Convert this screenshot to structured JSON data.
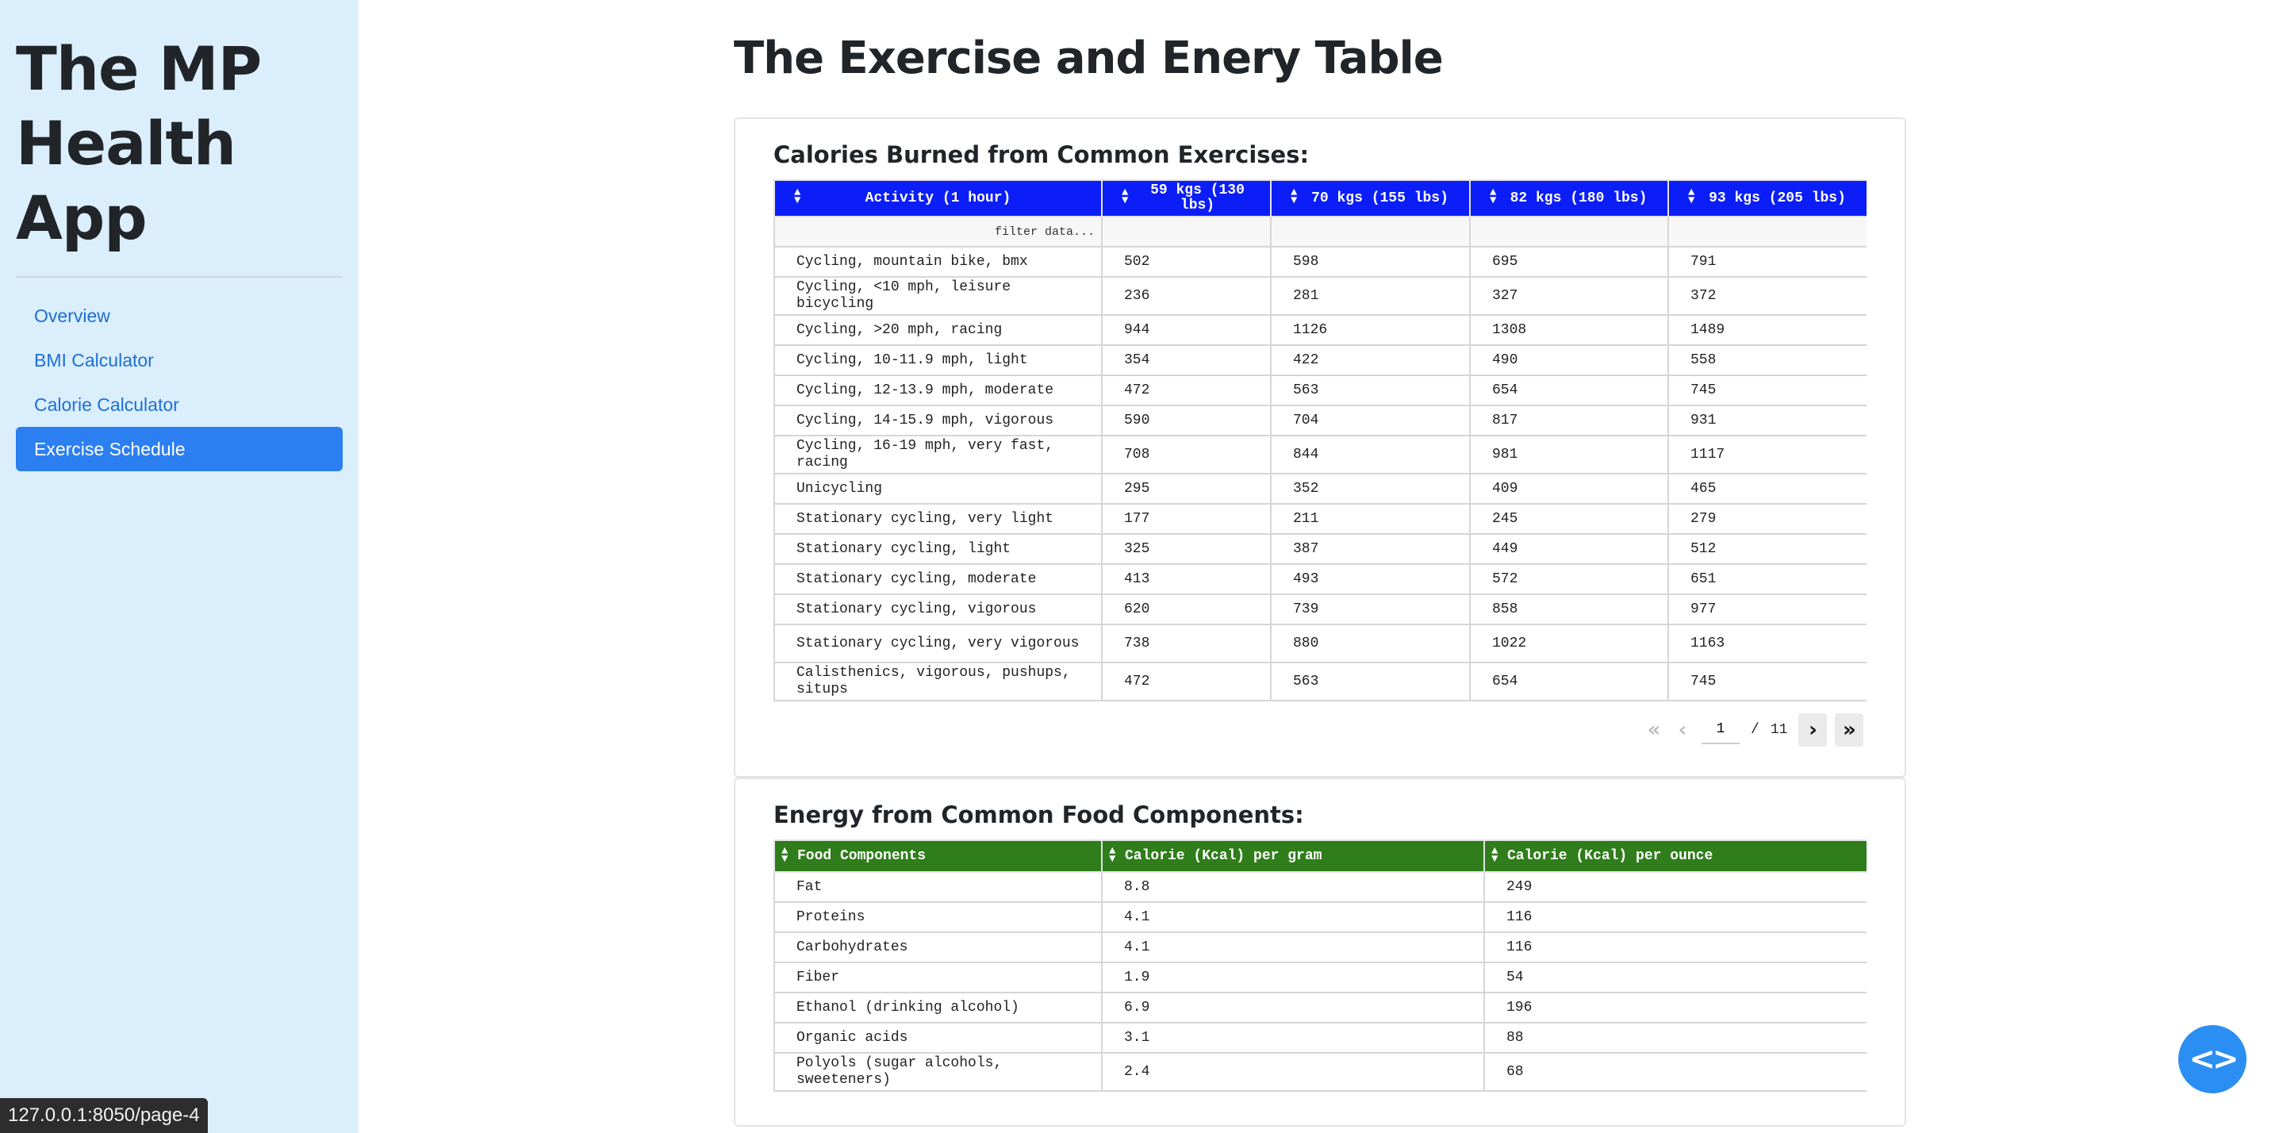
{
  "sidebar": {
    "title": "The MP Health App",
    "nav": [
      {
        "label": "Overview"
      },
      {
        "label": "BMI Calculator"
      },
      {
        "label": "Calorie Calculator"
      },
      {
        "label": "Exercise Schedule"
      }
    ]
  },
  "main": {
    "title": "The Exercise and Enery Table"
  },
  "exercise_table": {
    "heading": "Calories Burned from Common Exercises:",
    "columns": [
      "Activity (1 hour)",
      "59 kgs (130 lbs)",
      "70 kgs (155 lbs)",
      "82 kgs (180 lbs)",
      "93 kgs (205 lbs)"
    ],
    "filter_placeholder": "filter data...",
    "rows": [
      [
        "Cycling, mountain bike, bmx",
        "502",
        "598",
        "695",
        "791"
      ],
      [
        "Cycling, <10 mph, leisure bicycling",
        "236",
        "281",
        "327",
        "372"
      ],
      [
        "Cycling, >20 mph, racing",
        "944",
        "1126",
        "1308",
        "1489"
      ],
      [
        "Cycling, 10-11.9 mph, light",
        "354",
        "422",
        "490",
        "558"
      ],
      [
        "Cycling, 12-13.9 mph, moderate",
        "472",
        "563",
        "654",
        "745"
      ],
      [
        "Cycling, 14-15.9 mph, vigorous",
        "590",
        "704",
        "817",
        "931"
      ],
      [
        "Cycling, 16-19 mph, very fast, racing",
        "708",
        "844",
        "981",
        "1117"
      ],
      [
        "Unicycling",
        "295",
        "352",
        "409",
        "465"
      ],
      [
        "Stationary cycling, very light",
        "177",
        "211",
        "245",
        "279"
      ],
      [
        "Stationary cycling, light",
        "325",
        "387",
        "449",
        "512"
      ],
      [
        "Stationary cycling, moderate",
        "413",
        "493",
        "572",
        "651"
      ],
      [
        "Stationary cycling, vigorous",
        "620",
        "739",
        "858",
        "977"
      ],
      [
        "Stationary cycling, very vigorous",
        "738",
        "880",
        "1022",
        "1163"
      ],
      [
        "Calisthenics, vigorous, pushups, situps",
        "472",
        "563",
        "654",
        "745"
      ]
    ],
    "pagination": {
      "current": "1",
      "separator": "/",
      "total": "11"
    }
  },
  "food_table": {
    "heading": "Energy from Common Food Components:",
    "columns": [
      "Food Components",
      "Calorie (Kcal) per gram",
      "Calorie (Kcal) per ounce"
    ],
    "rows": [
      [
        "Fat",
        "8.8",
        "249"
      ],
      [
        "Proteins",
        "4.1",
        "116"
      ],
      [
        "Carbohydrates",
        "4.1",
        "116"
      ],
      [
        "Fiber",
        "1.9",
        "54"
      ],
      [
        "Ethanol (drinking alcohol)",
        "6.9",
        "196"
      ],
      [
        "Organic acids",
        "3.1",
        "88"
      ],
      [
        "Polyols (sugar alcohols, sweeteners)",
        "2.4",
        "68"
      ]
    ]
  },
  "status_url": "127.0.0.1:8050/page-4",
  "colors": {
    "sidebar_bg": "#dbeefc",
    "nav_active": "#2b7ff0",
    "exercise_header": "#0b1ef8",
    "food_header": "#2f7d1b",
    "fab": "#2b8ef2"
  },
  "icons": {
    "sort": "sort-arrows-icon",
    "first": "double-chevron-left-icon",
    "prev": "chevron-left-icon",
    "next": "chevron-right-icon",
    "last": "double-chevron-right-icon",
    "fab": "code-brackets-icon"
  }
}
